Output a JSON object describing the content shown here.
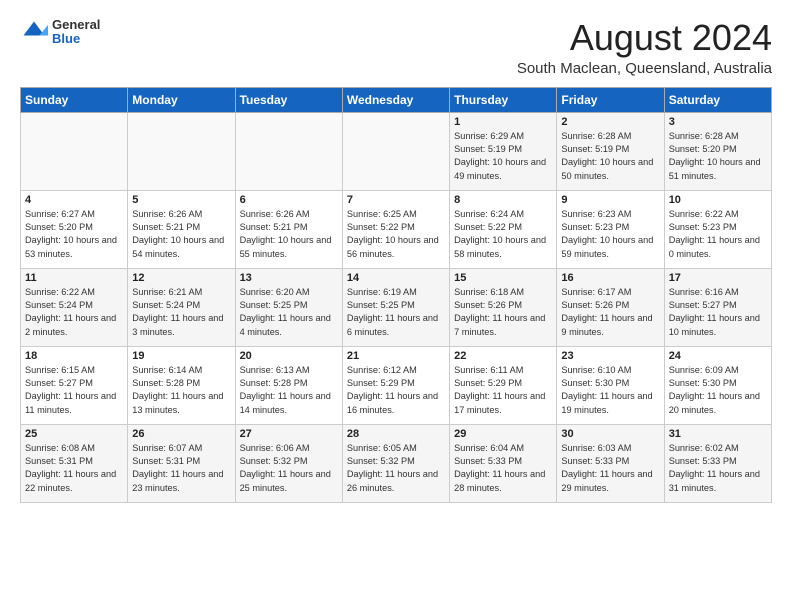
{
  "header": {
    "logo": {
      "general": "General",
      "blue": "Blue"
    },
    "title": "August 2024",
    "subtitle": "South Maclean, Queensland, Australia"
  },
  "weekdays": [
    "Sunday",
    "Monday",
    "Tuesday",
    "Wednesday",
    "Thursday",
    "Friday",
    "Saturday"
  ],
  "weeks": [
    [
      {
        "day": "",
        "data": ""
      },
      {
        "day": "",
        "data": ""
      },
      {
        "day": "",
        "data": ""
      },
      {
        "day": "",
        "data": ""
      },
      {
        "day": "1",
        "data": "Sunrise: 6:29 AM\nSunset: 5:19 PM\nDaylight: 10 hours and 49 minutes."
      },
      {
        "day": "2",
        "data": "Sunrise: 6:28 AM\nSunset: 5:19 PM\nDaylight: 10 hours and 50 minutes."
      },
      {
        "day": "3",
        "data": "Sunrise: 6:28 AM\nSunset: 5:20 PM\nDaylight: 10 hours and 51 minutes."
      }
    ],
    [
      {
        "day": "4",
        "data": "Sunrise: 6:27 AM\nSunset: 5:20 PM\nDaylight: 10 hours and 53 minutes."
      },
      {
        "day": "5",
        "data": "Sunrise: 6:26 AM\nSunset: 5:21 PM\nDaylight: 10 hours and 54 minutes."
      },
      {
        "day": "6",
        "data": "Sunrise: 6:26 AM\nSunset: 5:21 PM\nDaylight: 10 hours and 55 minutes."
      },
      {
        "day": "7",
        "data": "Sunrise: 6:25 AM\nSunset: 5:22 PM\nDaylight: 10 hours and 56 minutes."
      },
      {
        "day": "8",
        "data": "Sunrise: 6:24 AM\nSunset: 5:22 PM\nDaylight: 10 hours and 58 minutes."
      },
      {
        "day": "9",
        "data": "Sunrise: 6:23 AM\nSunset: 5:23 PM\nDaylight: 10 hours and 59 minutes."
      },
      {
        "day": "10",
        "data": "Sunrise: 6:22 AM\nSunset: 5:23 PM\nDaylight: 11 hours and 0 minutes."
      }
    ],
    [
      {
        "day": "11",
        "data": "Sunrise: 6:22 AM\nSunset: 5:24 PM\nDaylight: 11 hours and 2 minutes."
      },
      {
        "day": "12",
        "data": "Sunrise: 6:21 AM\nSunset: 5:24 PM\nDaylight: 11 hours and 3 minutes."
      },
      {
        "day": "13",
        "data": "Sunrise: 6:20 AM\nSunset: 5:25 PM\nDaylight: 11 hours and 4 minutes."
      },
      {
        "day": "14",
        "data": "Sunrise: 6:19 AM\nSunset: 5:25 PM\nDaylight: 11 hours and 6 minutes."
      },
      {
        "day": "15",
        "data": "Sunrise: 6:18 AM\nSunset: 5:26 PM\nDaylight: 11 hours and 7 minutes."
      },
      {
        "day": "16",
        "data": "Sunrise: 6:17 AM\nSunset: 5:26 PM\nDaylight: 11 hours and 9 minutes."
      },
      {
        "day": "17",
        "data": "Sunrise: 6:16 AM\nSunset: 5:27 PM\nDaylight: 11 hours and 10 minutes."
      }
    ],
    [
      {
        "day": "18",
        "data": "Sunrise: 6:15 AM\nSunset: 5:27 PM\nDaylight: 11 hours and 11 minutes."
      },
      {
        "day": "19",
        "data": "Sunrise: 6:14 AM\nSunset: 5:28 PM\nDaylight: 11 hours and 13 minutes."
      },
      {
        "day": "20",
        "data": "Sunrise: 6:13 AM\nSunset: 5:28 PM\nDaylight: 11 hours and 14 minutes."
      },
      {
        "day": "21",
        "data": "Sunrise: 6:12 AM\nSunset: 5:29 PM\nDaylight: 11 hours and 16 minutes."
      },
      {
        "day": "22",
        "data": "Sunrise: 6:11 AM\nSunset: 5:29 PM\nDaylight: 11 hours and 17 minutes."
      },
      {
        "day": "23",
        "data": "Sunrise: 6:10 AM\nSunset: 5:30 PM\nDaylight: 11 hours and 19 minutes."
      },
      {
        "day": "24",
        "data": "Sunrise: 6:09 AM\nSunset: 5:30 PM\nDaylight: 11 hours and 20 minutes."
      }
    ],
    [
      {
        "day": "25",
        "data": "Sunrise: 6:08 AM\nSunset: 5:31 PM\nDaylight: 11 hours and 22 minutes."
      },
      {
        "day": "26",
        "data": "Sunrise: 6:07 AM\nSunset: 5:31 PM\nDaylight: 11 hours and 23 minutes."
      },
      {
        "day": "27",
        "data": "Sunrise: 6:06 AM\nSunset: 5:32 PM\nDaylight: 11 hours and 25 minutes."
      },
      {
        "day": "28",
        "data": "Sunrise: 6:05 AM\nSunset: 5:32 PM\nDaylight: 11 hours and 26 minutes."
      },
      {
        "day": "29",
        "data": "Sunrise: 6:04 AM\nSunset: 5:33 PM\nDaylight: 11 hours and 28 minutes."
      },
      {
        "day": "30",
        "data": "Sunrise: 6:03 AM\nSunset: 5:33 PM\nDaylight: 11 hours and 29 minutes."
      },
      {
        "day": "31",
        "data": "Sunrise: 6:02 AM\nSunset: 5:33 PM\nDaylight: 11 hours and 31 minutes."
      }
    ]
  ]
}
